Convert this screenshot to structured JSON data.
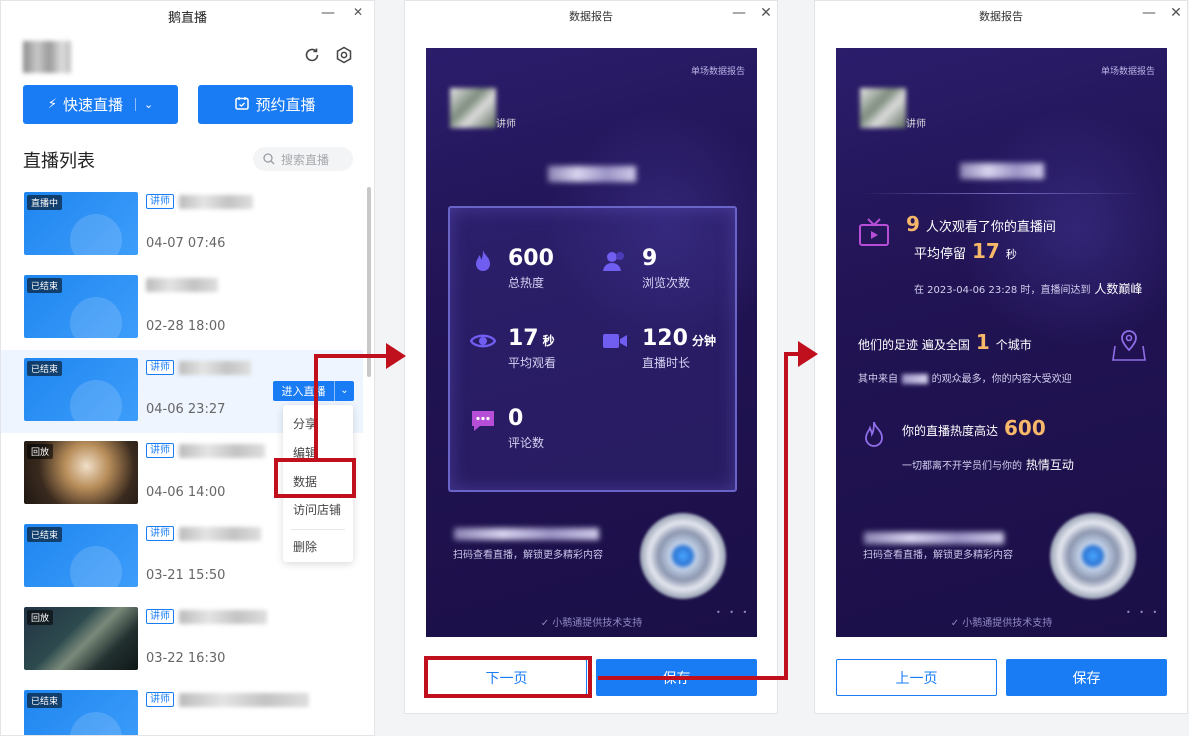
{
  "left_window": {
    "title": "鹅直播",
    "minimize": "—",
    "close": "✕",
    "refresh_icon": "refresh-icon",
    "settings_icon": "settings-icon",
    "quick_live_label": "快速直播",
    "schedule_live_label": "预约直播",
    "list_title": "直播列表",
    "search_placeholder": "搜索直播",
    "rows": [
      {
        "tag": "直播中",
        "lecturer": "讲师",
        "date": "04-07 07:46"
      },
      {
        "tag": "已结束",
        "lecturer": "",
        "date": "02-28 18:00"
      },
      {
        "tag": "已结束",
        "lecturer": "讲师",
        "date": "04-06 23:27"
      },
      {
        "tag": "回放",
        "lecturer": "讲师",
        "date": "04-06 14:00"
      },
      {
        "tag": "已结束",
        "lecturer": "讲师",
        "date": "03-21 15:50"
      },
      {
        "tag": "回放",
        "lecturer": "讲师",
        "date": "03-22 16:30"
      },
      {
        "tag": "已结束",
        "lecturer": "讲师",
        "date": ""
      }
    ],
    "enter_button": "进入直播",
    "menu": [
      "分享",
      "编辑",
      "数据",
      "访问店铺",
      "删除"
    ]
  },
  "report_page1": {
    "title": "数据报告",
    "corner_label": "单场数据报告",
    "lecturer_label": "讲师",
    "stats": [
      {
        "value": "600",
        "unit": "",
        "label": "总热度",
        "icon": "flame-icon"
      },
      {
        "value": "9",
        "unit": "",
        "label": "浏览次数",
        "icon": "users-icon"
      },
      {
        "value": "17",
        "unit": "秒",
        "label": "平均观看",
        "icon": "eye-icon"
      },
      {
        "value": "120",
        "unit": "分钟",
        "label": "直播时长",
        "icon": "video-icon"
      },
      {
        "value": "0",
        "unit": "",
        "label": "评论数",
        "icon": "comment-icon"
      }
    ],
    "qr_hint": "扫码查看直播，解锁更多精彩内容",
    "support": "小鹅通提供技术支持",
    "next_button": "下一页",
    "save_button": "保存"
  },
  "report_page2": {
    "title": "数据报告",
    "corner_label": "单场数据报告",
    "lecturer_label": "讲师",
    "viewers_count": "9",
    "viewers_text": "人次观看了你的直播间",
    "avg_stay_label": "平均停留",
    "avg_stay_value": "17",
    "avg_stay_unit": "秒",
    "peak_text": "在 2023-04-06 23:28 时，直播间达到",
    "peak_label": "人数巅峰",
    "footprint_prefix": "他们的足迹 遍及全国",
    "city_count": "1",
    "city_suffix": "个城市",
    "most_from_prefix": "其中来自",
    "most_from_suffix": "的观众最多，你的内容大受欢迎",
    "heat_prefix": "你的直播热度高达",
    "heat_value": "600",
    "interaction_prefix": "一切都离不开学员们与你的",
    "interaction_label": "热情互动",
    "qr_hint": "扫码查看直播，解锁更多精彩内容",
    "support": "小鹅通提供技术支持",
    "prev_button": "上一页",
    "save_button": "保存"
  },
  "colors": {
    "accent": "#1a7cf5",
    "annotation": "#c0101e",
    "highlight_number": "#f8b86a"
  }
}
